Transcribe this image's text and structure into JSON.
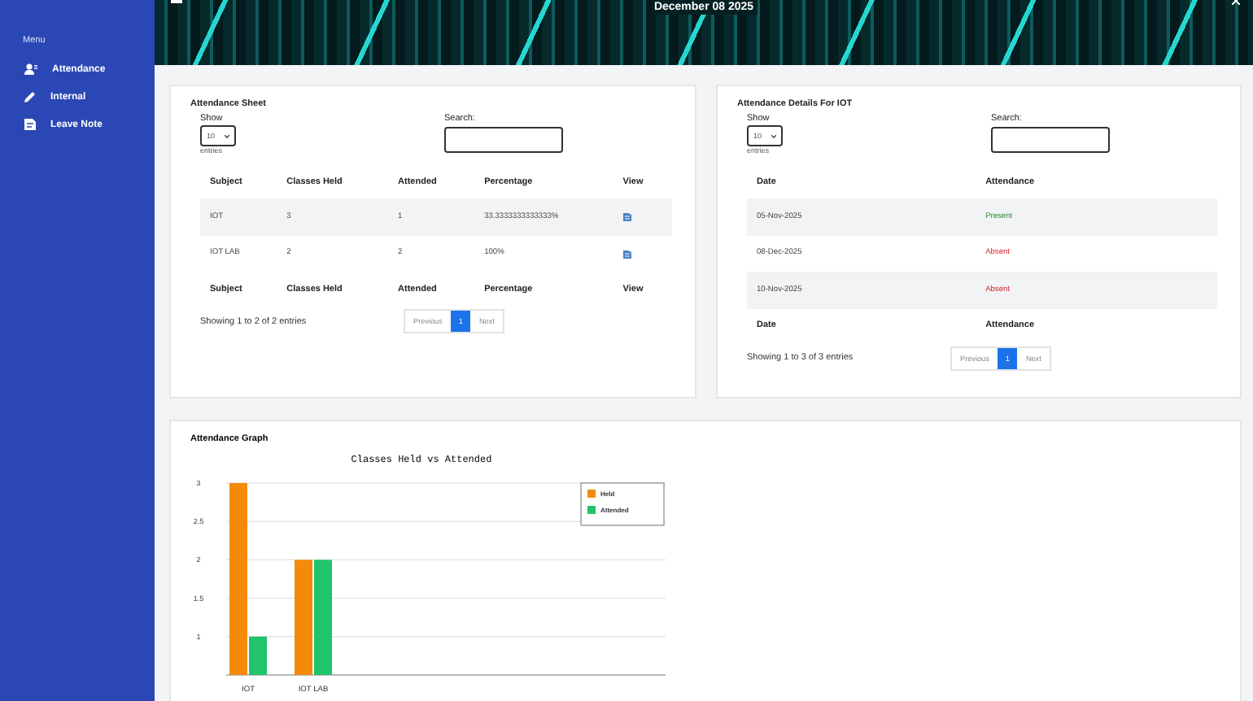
{
  "sidebar": {
    "heading": "Menu",
    "items": [
      {
        "label": "Attendance",
        "kind": "user"
      },
      {
        "label": "Internal",
        "kind": "pencil"
      },
      {
        "label": "Leave Note",
        "kind": "note"
      }
    ]
  },
  "header": {
    "date": "December 08 2025"
  },
  "attendance_sheet": {
    "title": "Attendance Sheet",
    "show_label": "Show",
    "page_size": "10",
    "entries_label": "entries",
    "search_label": "Search:",
    "columns": [
      {
        "label": "Subject",
        "kind": "text"
      },
      {
        "label": "Classes Held",
        "kind": "text"
      },
      {
        "label": "Attended",
        "kind": "text"
      },
      {
        "label": "Percentage",
        "kind": "text"
      },
      {
        "label": "View",
        "kind": "icon"
      }
    ],
    "rows": [
      {
        "cells": [
          "IOT",
          "3",
          "1",
          "33.3333333333333%"
        ]
      },
      {
        "cells": [
          "IOT LAB",
          "2",
          "2",
          "100%"
        ]
      }
    ],
    "footer_columns": [
      "Subject",
      "Classes Held",
      "Attended",
      "Percentage",
      "View"
    ],
    "info": "Showing 1 to 2 of 2 entries",
    "pagination": [
      {
        "label": "Previous",
        "selected": false
      },
      {
        "label": "1",
        "selected": true
      },
      {
        "label": "Next",
        "selected": false
      }
    ]
  },
  "attendance_details": {
    "title": "Attendance Details For IOT",
    "show_label": "Show",
    "page_size": "10",
    "entries_label": "entries",
    "search_label": "Search:",
    "columns": [
      {
        "label": "Date",
        "kind": "text"
      },
      {
        "label": "Attendance",
        "kind": "status"
      }
    ],
    "rows": [
      {
        "cells": [
          "05-Nov-2025",
          "Present"
        ],
        "kind": "present"
      },
      {
        "cells": [
          "08-Dec-2025",
          "Absent"
        ],
        "kind": "absent"
      },
      {
        "cells": [
          "10-Nov-2025",
          "Absent"
        ],
        "kind": "absent"
      }
    ],
    "footer_columns": [
      "Date",
      "Attendance"
    ],
    "info": "Showing 1 to 3 of 3 entries",
    "pagination": [
      {
        "label": "Previous",
        "selected": false
      },
      {
        "label": "1",
        "selected": true
      },
      {
        "label": "Next",
        "selected": false
      }
    ]
  },
  "attendance_graph": {
    "title": "Attendance Graph",
    "chart_data": {
      "type": "bar",
      "title": "Classes Held vs Attended",
      "categories": [
        "IOT",
        "IOT LAB"
      ],
      "series": [
        {
          "name": "Held",
          "color": "#f5890a",
          "values": [
            3,
            2
          ]
        },
        {
          "name": "Attended",
          "color": "#1fc46b",
          "values": [
            1,
            2
          ]
        }
      ],
      "ylim": [
        0.5,
        3
      ],
      "yticks": [
        {
          "value": 1,
          "label": "1"
        },
        {
          "value": 1.5,
          "label": "1.5"
        },
        {
          "value": 2,
          "label": "2"
        },
        {
          "value": 2.5,
          "label": "2.5"
        },
        {
          "value": 3,
          "label": "3"
        }
      ],
      "grid": true,
      "legend": true
    }
  }
}
